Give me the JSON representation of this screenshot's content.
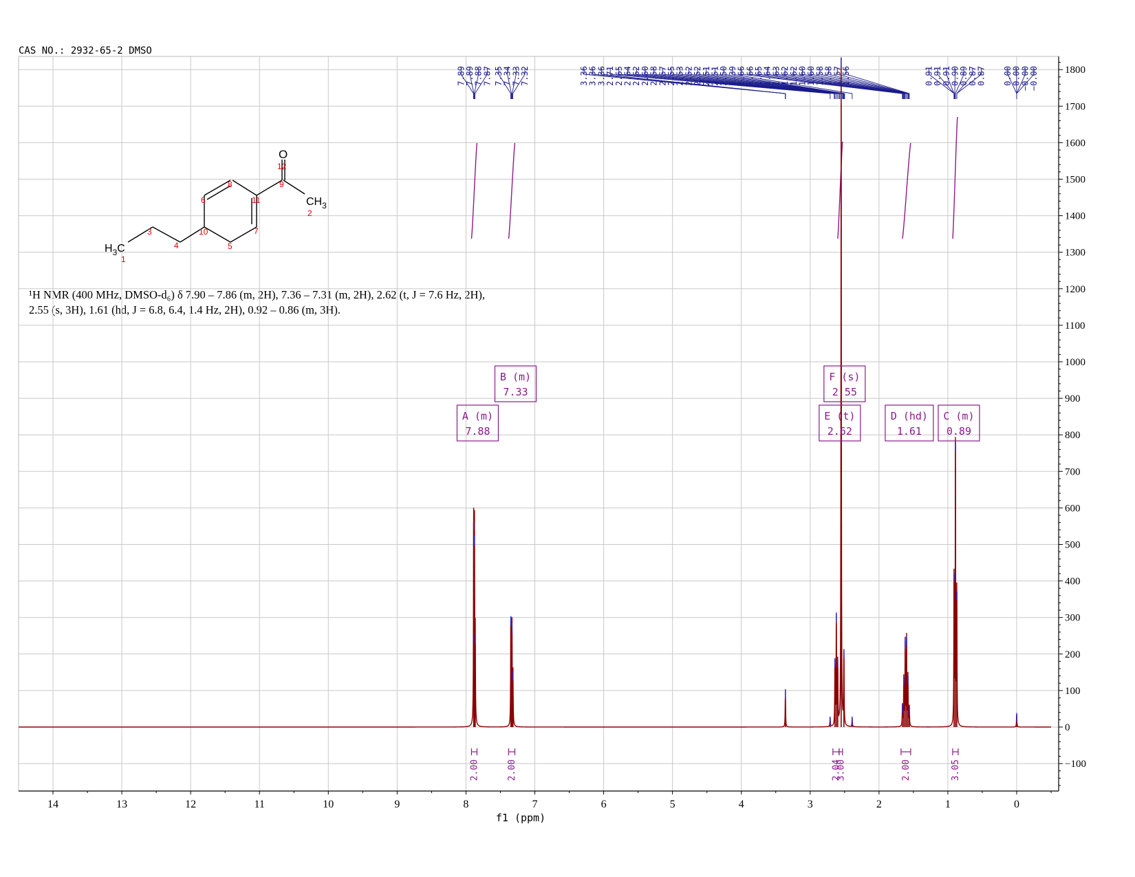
{
  "header": "CAS NO.: 2932-65-2 DMSO",
  "nmr_description": {
    "line1": "¹H NMR (400 MHz, DMSO-d₆) δ 7.90 – 7.86 (m, 2H), 7.36 – 7.31 (m, 2H), 2.62 (t, J = 7.6 Hz, 2H),",
    "line2": "2.55 (s, 3H), 1.61 (hd, J = 6.8, 6.4, 1.4 Hz, 2H), 0.92 – 0.86 (m, 3H)."
  },
  "colors": {
    "spectrum": "#8b0000",
    "peak_labels": "#1a1a8c",
    "integrals": "#8b1a8b",
    "grid": "#c8c8c8",
    "axis": "#000000"
  },
  "structure": {
    "atoms": {
      "o": "O",
      "ch3_right": "CH",
      "ch3_right_sub": "3",
      "h3c_left": "H",
      "h3c_left_sub": "3",
      "h3c_left_c": "C"
    },
    "numbers": [
      "1",
      "2",
      "3",
      "4",
      "5",
      "6",
      "7",
      "8",
      "9",
      "10",
      "11",
      "12"
    ]
  },
  "chart_data": {
    "type": "line",
    "title": "",
    "xlabel": "f1 (ppm)",
    "ylabel": "",
    "xlim": [
      14.5,
      -0.5
    ],
    "ylim": [
      -170,
      1830
    ],
    "x_reversed": true,
    "x_ticks": [
      "14",
      "13",
      "12",
      "11",
      "10",
      "9",
      "8",
      "7",
      "6",
      "5",
      "4",
      "3",
      "2",
      "1",
      "0"
    ],
    "y_ticks": [
      "1800",
      "1700",
      "1600",
      "1500",
      "1400",
      "1300",
      "1200",
      "1100",
      "1000",
      "900",
      "800",
      "700",
      "600",
      "500",
      "400",
      "300",
      "200",
      "100",
      "0",
      "−100"
    ],
    "peaks": [
      {
        "ppm": 7.888,
        "height": 560
      },
      {
        "ppm": 7.877,
        "height": 520
      },
      {
        "ppm": 7.866,
        "height": 250
      },
      {
        "ppm": 7.348,
        "height": 300
      },
      {
        "ppm": 7.332,
        "height": 280
      },
      {
        "ppm": 7.318,
        "height": 150
      },
      {
        "ppm": 3.36,
        "height": 100
      },
      {
        "ppm": 2.71,
        "height": 25
      },
      {
        "ppm": 2.64,
        "height": 185
      },
      {
        "ppm": 2.62,
        "height": 310
      },
      {
        "ppm": 2.6,
        "height": 185
      },
      {
        "ppm": 2.55,
        "height": 1830
      },
      {
        "ppm": 2.51,
        "height": 210
      },
      {
        "ppm": 2.39,
        "height": 25
      },
      {
        "ppm": 1.66,
        "height": 60
      },
      {
        "ppm": 1.64,
        "height": 135
      },
      {
        "ppm": 1.62,
        "height": 235
      },
      {
        "ppm": 1.6,
        "height": 245
      },
      {
        "ppm": 1.58,
        "height": 140
      },
      {
        "ppm": 1.56,
        "height": 55
      },
      {
        "ppm": 0.91,
        "height": 420
      },
      {
        "ppm": 0.89,
        "height": 780
      },
      {
        "ppm": 0.87,
        "height": 370
      },
      {
        "ppm": 0.0,
        "height": 35
      }
    ],
    "peak_label_groups": [
      {
        "labels": [
          "7.89",
          "7.89",
          "7.88",
          "7.87"
        ],
        "ppms": [
          7.89,
          7.885,
          7.88,
          7.87
        ]
      },
      {
        "labels": [
          "7.35",
          "7.34",
          "7.33",
          "7.32"
        ],
        "ppms": [
          7.35,
          7.34,
          7.33,
          7.32
        ]
      },
      {
        "labels": [
          "3.36",
          "3.36",
          "3.36",
          "2.71",
          "2.65",
          "2.64",
          "2.62",
          "2.60",
          "2.58",
          "2.57",
          "2.55",
          "2.53",
          "2.52",
          "2.52",
          "2.51",
          "2.51",
          "2.50",
          "2.39",
          "1.66",
          "1.66",
          "1.65",
          "1.64",
          "1.63",
          "1.62",
          "1.62",
          "1.60",
          "1.60",
          "1.58",
          "1.58",
          "1.57",
          "1.56"
        ],
        "ppms": [
          3.36,
          3.36,
          3.36,
          2.71,
          2.65,
          2.64,
          2.62,
          2.6,
          2.58,
          2.57,
          2.55,
          2.53,
          2.52,
          2.52,
          2.51,
          2.51,
          2.5,
          2.39,
          1.66,
          1.66,
          1.65,
          1.64,
          1.63,
          1.62,
          1.62,
          1.6,
          1.6,
          1.58,
          1.58,
          1.57,
          1.56
        ]
      },
      {
        "labels": [
          "0.91",
          "0.91",
          "0.91",
          "0.90",
          "0.89",
          "0.87",
          "0.87"
        ],
        "ppms": [
          0.91,
          0.91,
          0.91,
          0.9,
          0.89,
          0.87,
          0.87
        ]
      },
      {
        "labels": [
          "0.00",
          "0.00",
          "−0.00",
          "−0.00"
        ],
        "ppms": [
          0.0,
          0.0,
          0.0,
          0.0
        ]
      }
    ],
    "multiplet_annotations": [
      {
        "id": "A",
        "label": "A (m)",
        "shift": "7.88",
        "ppm": 7.88,
        "row": "low"
      },
      {
        "id": "B",
        "label": "B (m)",
        "shift": "7.33",
        "ppm": 7.33,
        "row": "high"
      },
      {
        "id": "E",
        "label": "E (t)",
        "shift": "2.62",
        "ppm": 2.62,
        "row": "low"
      },
      {
        "id": "F",
        "label": "F (s)",
        "shift": "2.55",
        "ppm": 2.55,
        "row": "high"
      },
      {
        "id": "D",
        "label": "D (hd)",
        "shift": "1.61",
        "ppm": 1.61,
        "row": "low"
      },
      {
        "id": "C",
        "label": "C (m)",
        "shift": "0.89",
        "ppm": 0.89,
        "row": "low"
      }
    ],
    "integrals": [
      {
        "value": "2.00",
        "from": 7.92,
        "to": 7.84
      },
      {
        "value": "2.00",
        "from": 7.38,
        "to": 7.29
      },
      {
        "value": "2.04",
        "from": 2.67,
        "to": 2.58
      },
      {
        "value": "3.00",
        "from": 2.58,
        "to": 2.53
      },
      {
        "value": "2.00",
        "from": 1.68,
        "to": 1.54
      },
      {
        "value": "3.05",
        "from": 0.93,
        "to": 0.85
      }
    ]
  }
}
